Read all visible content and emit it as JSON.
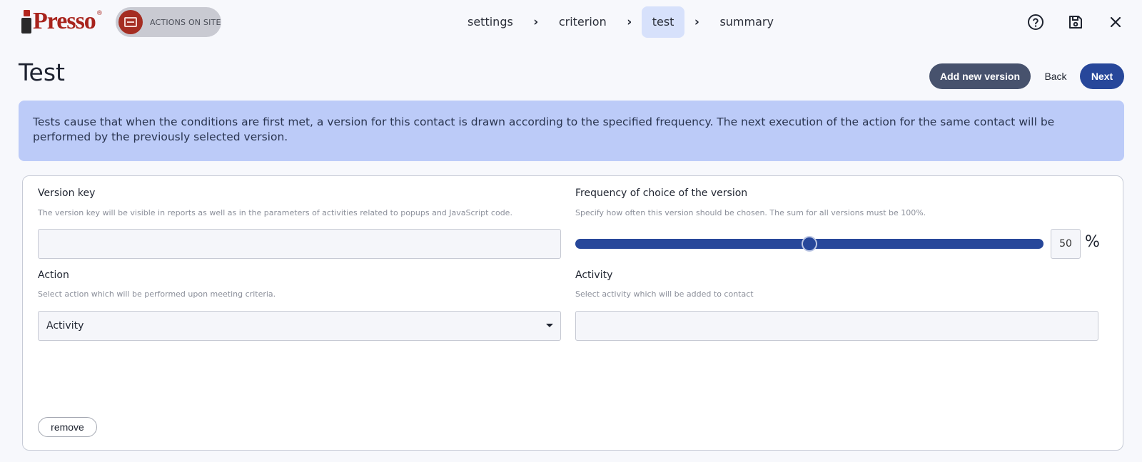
{
  "brand": {
    "logo_text": "Presso",
    "module_label": "ACTIONS ON SITE"
  },
  "wizard": {
    "steps": [
      {
        "label": "settings",
        "active": false
      },
      {
        "label": "criterion",
        "active": false
      },
      {
        "label": "test",
        "active": true
      },
      {
        "label": "summary",
        "active": false
      }
    ]
  },
  "top_icons": [
    "help-icon",
    "save-icon",
    "close-icon"
  ],
  "page": {
    "title": "Test",
    "buttons": {
      "add_version": "Add new version",
      "back": "Back",
      "next": "Next"
    },
    "info": "Tests cause that when the conditions are first met, a version for this contact is drawn according to the specified frequency. The next execution of the action for the same contact will be performed by the previously selected version."
  },
  "version": {
    "version_key": {
      "label": "Version key",
      "help": "The version key will be visible in reports as well as in the parameters of activities related to popups and JavaScript code.",
      "value": ""
    },
    "frequency": {
      "label": "Frequency of choice of the version",
      "help": "Specify how often this version should be chosen. The sum for all versions must be 100%.",
      "value": "50",
      "unit": "%"
    },
    "action": {
      "label": "Action",
      "help": "Select action which will be performed upon meeting criteria.",
      "selected": "Activity"
    },
    "activity": {
      "label": "Activity",
      "help": "Select activity which will be added to contact",
      "value": ""
    },
    "remove_label": "remove"
  },
  "colors": {
    "primary": "#27479a",
    "secondary": "#47526d",
    "info_bg": "#bccbf8",
    "brand_red": "#a8231c"
  }
}
